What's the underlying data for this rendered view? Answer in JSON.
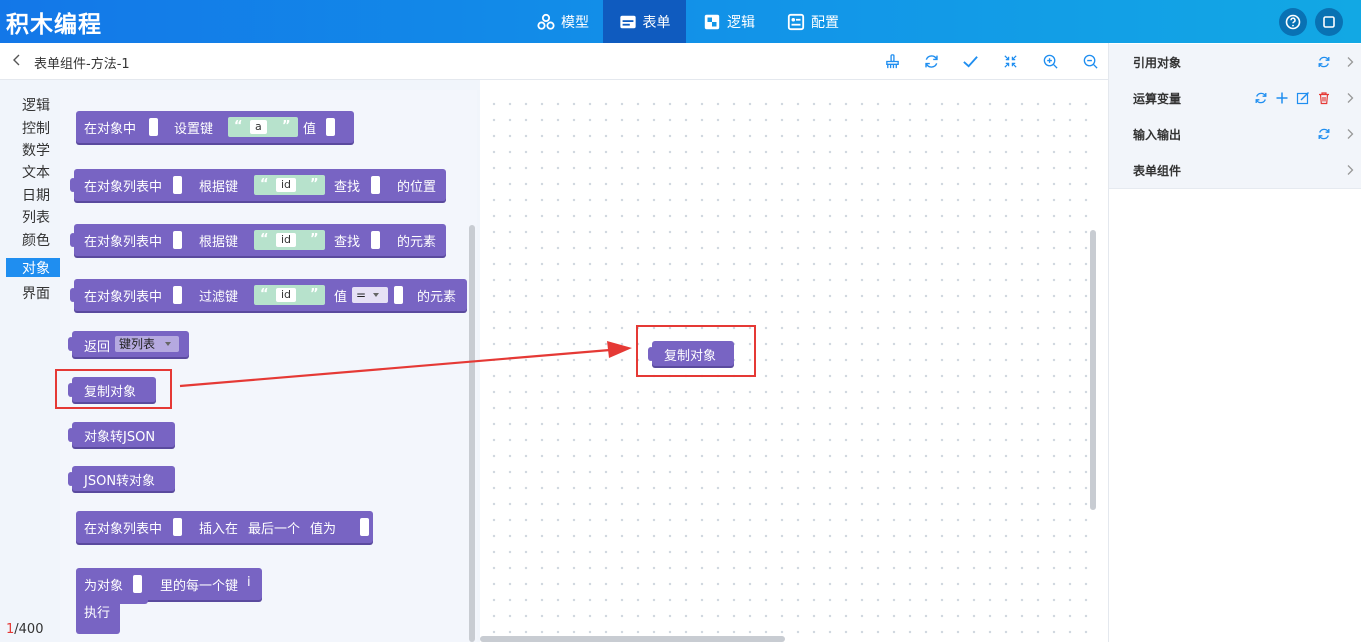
{
  "app": {
    "logo": "积木编程"
  },
  "nav": [
    {
      "label": "模型",
      "icon": "cluster-icon",
      "active": false
    },
    {
      "label": "表单",
      "icon": "form-icon",
      "active": true
    },
    {
      "label": "逻辑",
      "icon": "puzzle-icon",
      "active": false
    },
    {
      "label": "配置",
      "icon": "config-icon",
      "active": false
    }
  ],
  "header_buttons": [
    {
      "icon": "help-icon"
    },
    {
      "icon": "window-icon"
    }
  ],
  "subbar": {
    "breadcrumb": "表单组件-方法-1"
  },
  "toolbar": [
    "clean-icon",
    "refresh-icon",
    "check-icon",
    "collapse-icon",
    "zoom-in-icon",
    "zoom-out-icon"
  ],
  "categories": [
    {
      "label": "逻辑",
      "active": false
    },
    {
      "label": "控制",
      "active": false
    },
    {
      "label": "数学",
      "active": false
    },
    {
      "label": "文本",
      "active": false
    },
    {
      "label": "日期",
      "active": false
    },
    {
      "label": "列表",
      "active": false
    },
    {
      "label": "颜色",
      "active": false
    },
    {
      "label": "对象",
      "active": true
    },
    {
      "label": "界面",
      "active": false
    }
  ],
  "counter": {
    "current": "1",
    "total": "/400"
  },
  "blocks": {
    "b1": {
      "a": "在对象中",
      "b": "设置键",
      "s": "a",
      "c": "值"
    },
    "b2": {
      "a": "在对象列表中",
      "b": "根据键",
      "s": "id",
      "c": "查找",
      "d": "的位置"
    },
    "b3": {
      "a": "在对象列表中",
      "b": "根据键",
      "s": "id",
      "c": "查找",
      "d": "的元素"
    },
    "b4": {
      "a": "在对象列表中",
      "b": "过滤键",
      "s": "id",
      "c": "值",
      "op": "=",
      "d": "的元素"
    },
    "b5": {
      "a": "返回",
      "dd": "键列表"
    },
    "b6": {
      "a": "复制对象"
    },
    "b7": {
      "a": "对象转JSON"
    },
    "b8": {
      "a": "JSON转对象"
    },
    "b9": {
      "a": "在对象列表中",
      "b": "插入在",
      "c": "最后一个",
      "d": "值为"
    },
    "b10": {
      "a": "为对象",
      "b": "里的每一个键",
      "var": "i",
      "do": "执行"
    }
  },
  "canvas_block": {
    "label": "复制对象"
  },
  "quote": "“ ”",
  "quote_open": "“",
  "quote_close": "”",
  "right_panel": [
    {
      "label": "引用对象",
      "icons": [
        "refresh-icon"
      ]
    },
    {
      "label": "运算变量",
      "icons": [
        "refresh-icon",
        "plus-icon",
        "edit-icon",
        "delete-icon"
      ]
    },
    {
      "label": "输入输出",
      "icons": [
        "refresh-icon"
      ]
    },
    {
      "label": "表单组件",
      "icons": []
    }
  ],
  "colors": {
    "accent": "#1f8ef0",
    "block": "#7864c3",
    "string": "#b7e2cc",
    "highlight": "#e53935",
    "delete": "#e53935"
  }
}
